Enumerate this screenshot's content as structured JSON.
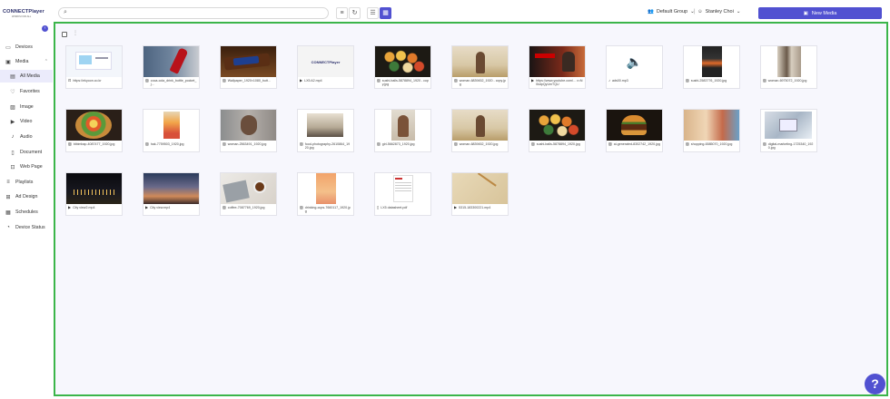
{
  "logo": {
    "main": "CONNECTPlayer",
    "sub": "WORKS FOR ALL"
  },
  "sidebar": {
    "collapse_glyph": "‹",
    "items": [
      {
        "label": "Devices",
        "icon": "monitor-icon",
        "glyph": "▭",
        "active": false,
        "sub": false
      },
      {
        "label": "Media",
        "icon": "media-icon",
        "glyph": "▣",
        "active": false,
        "sub": false,
        "expanded": true
      },
      {
        "label": "All Media",
        "icon": "all-media-icon",
        "glyph": "▤",
        "active": true,
        "sub": true
      },
      {
        "label": "Favorites",
        "icon": "heart-icon",
        "glyph": "♡",
        "active": false,
        "sub": true
      },
      {
        "label": "Image",
        "icon": "image-icon",
        "glyph": "▨",
        "active": false,
        "sub": true
      },
      {
        "label": "Video",
        "icon": "video-icon",
        "glyph": "▶",
        "active": false,
        "sub": true
      },
      {
        "label": "Audio",
        "icon": "audio-icon",
        "glyph": "♪",
        "active": false,
        "sub": true
      },
      {
        "label": "Document",
        "icon": "document-icon",
        "glyph": "▯",
        "active": false,
        "sub": true
      },
      {
        "label": "Web Page",
        "icon": "web-icon",
        "glyph": "⊡",
        "active": false,
        "sub": true
      },
      {
        "label": "Playlists",
        "icon": "playlist-icon",
        "glyph": "≡",
        "active": false,
        "sub": false
      },
      {
        "label": "Ad Design",
        "icon": "design-icon",
        "glyph": "⊞",
        "active": false,
        "sub": false
      },
      {
        "label": "Schedules",
        "icon": "calendar-icon",
        "glyph": "▦",
        "active": false,
        "sub": false
      },
      {
        "label": "Device Status",
        "icon": "status-icon",
        "glyph": "◔",
        "active": false,
        "sub": false
      }
    ]
  },
  "topbar": {
    "search_placeholder": "",
    "group": "Default Group",
    "user": "Stanley Choi",
    "new_media_label": "New Media"
  },
  "colors": {
    "accent": "#5151d1",
    "content_border": "#3bb54a",
    "content_bg": "#f7f7fd"
  },
  "media": [
    {
      "name": "https://ekyoon.co.kr",
      "type": "web",
      "thumb": "web"
    },
    {
      "name": "coca-cola_drink_bottle_pocket_j...",
      "type": "image",
      "thumb": "coke"
    },
    {
      "name": "Wallpaper_1920×1080_butt...",
      "type": "image",
      "thumb": "snickers"
    },
    {
      "name": "LX5 A2.mp4",
      "type": "video",
      "thumb": "logo"
    },
    {
      "name": "sushi-balls-5878894_1920 - copy.jpg",
      "type": "image",
      "thumb": "sushi"
    },
    {
      "name": "woman-6839452_1920 - copy.jpg",
      "type": "image",
      "thumb": "woman-field"
    },
    {
      "name": "https://www.youtube.com/... v=N0kdpQyUmTQU",
      "type": "youtube",
      "thumb": "movie"
    },
    {
      "name": "ads00.mp3",
      "type": "audio",
      "thumb": "audio"
    },
    {
      "name": "sushi-2583776_1920.jpg",
      "type": "image",
      "thumb": "sushi2"
    },
    {
      "name": "woman-6975072_1920.jpg",
      "type": "image",
      "thumb": "runway"
    },
    {
      "name": "bibimbap-4087477_1920.jpg",
      "type": "image",
      "thumb": "bibimbap"
    },
    {
      "name": "hak-7759503_1920.jpg",
      "type": "image",
      "thumb": "drinks"
    },
    {
      "name": "woman-2563491_1920.jpg",
      "type": "image",
      "thumb": "woman-face"
    },
    {
      "name": "food-photography-2610864_1920.jpg",
      "type": "image",
      "thumb": "typewriter"
    },
    {
      "name": "girl-5662873_1920.jpg",
      "type": "image",
      "thumb": "girl"
    },
    {
      "name": "woman-6839452_1920.jpg",
      "type": "image",
      "thumb": "woman-field"
    },
    {
      "name": "sushi-balls-5878894_1920.jpg",
      "type": "image",
      "thumb": "sushi"
    },
    {
      "name": "ai-generated-8302742_1920.jpg",
      "type": "image",
      "thumb": "burger"
    },
    {
      "name": "shopping-6585070_1920.jpg",
      "type": "image",
      "thumb": "shopping"
    },
    {
      "name": "digital-marketing-1725340_1920.jpg",
      "type": "image",
      "thumb": "tablet"
    },
    {
      "name": "City view2.mp4",
      "type": "video",
      "thumb": "city-night"
    },
    {
      "name": "City view.mp4",
      "type": "video",
      "thumb": "city-dusk"
    },
    {
      "name": "coffee-7087769_1920.jpg",
      "type": "image",
      "thumb": "coffee"
    },
    {
      "name": "drinking-cups-7660117_1920.jpg",
      "type": "image",
      "thumb": "cups"
    },
    {
      "name": "LX5 datasheet.pdf",
      "type": "pdf",
      "thumb": "pdf"
    },
    {
      "name": "5315-183300221.mp4",
      "type": "video",
      "thumb": "map"
    }
  ],
  "help_label": "?"
}
